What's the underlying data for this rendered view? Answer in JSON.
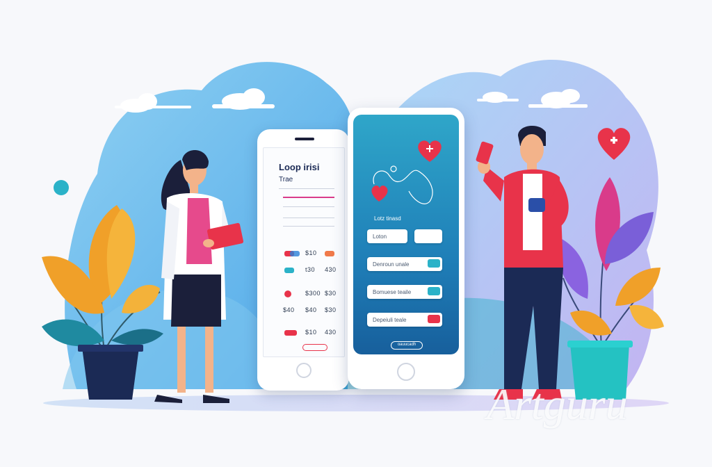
{
  "left_phone": {
    "title": "Loop irisi",
    "subtitle": "Trae",
    "rows": [
      {
        "value": "$10"
      },
      {
        "value": "t30"
      },
      {
        "value": "$300"
      },
      {
        "value": "$40"
      },
      {
        "value": "$30"
      }
    ],
    "row_labels": [
      "$40",
      "430",
      "$30"
    ]
  },
  "right_phone": {
    "header": "Lotz tinasd",
    "fields": [
      {
        "label": "Loton"
      },
      {
        "label": "Denroun unale"
      },
      {
        "label": "Bomuese teaile"
      },
      {
        "label": "Depeiuli teale"
      }
    ],
    "button_label": "oauucadh"
  },
  "watermark": "Artguru",
  "colors": {
    "sky_blue": "#5bb6ea",
    "lavender": "#b9b3f0",
    "teal": "#1fa8b8",
    "coral_red": "#e8334a",
    "orange": "#f0a029",
    "navy": "#1b2a55",
    "magenta": "#d93b8a"
  }
}
